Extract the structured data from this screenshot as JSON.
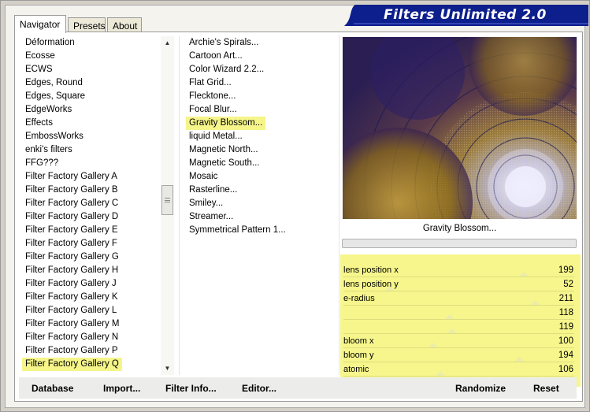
{
  "app": {
    "title": "Filters Unlimited 2.0"
  },
  "tabs": [
    {
      "label": "Navigator",
      "active": true
    },
    {
      "label": "Presets",
      "active": false
    },
    {
      "label": "About",
      "active": false
    }
  ],
  "categories": [
    "Déformation",
    "Ecosse",
    "ECWS",
    "Edges, Round",
    "Edges, Square",
    "EdgeWorks",
    "Effects",
    "EmbossWorks",
    "enki's filters",
    "FFG???",
    "Filter Factory Gallery A",
    "Filter Factory Gallery B",
    "Filter Factory Gallery C",
    "Filter Factory Gallery D",
    "Filter Factory Gallery E",
    "Filter Factory Gallery F",
    "Filter Factory Gallery G",
    "Filter Factory Gallery H",
    "Filter Factory Gallery J",
    "Filter Factory Gallery K",
    "Filter Factory Gallery L",
    "Filter Factory Gallery M",
    "Filter Factory Gallery N",
    "Filter Factory Gallery P",
    "Filter Factory Gallery Q"
  ],
  "selected_category": "Filter Factory Gallery Q",
  "filters": [
    "Archie's Spirals...",
    "Cartoon Art...",
    "Color Wizard 2.2...",
    "Flat Grid...",
    "Flecktone...",
    "Focal Blur...",
    "Gravity Blossom...",
    "liquid Metal...",
    "Magnetic North...",
    "Magnetic South...",
    "Mosaic",
    "Rasterline...",
    "Smiley...",
    "Streamer...",
    "Symmetrical Pattern 1..."
  ],
  "selected_filter": "Gravity Blossom...",
  "preview": {
    "caption": "Gravity Blossom..."
  },
  "params": [
    {
      "label": "lens position x",
      "value": "199",
      "level": 0.78
    },
    {
      "label": "lens position y",
      "value": "52",
      "level": 0.2
    },
    {
      "label": "e-radius",
      "value": "211",
      "level": 0.83
    },
    {
      "label": "",
      "value": "118",
      "level": 0.46
    },
    {
      "label": "",
      "value": "119",
      "level": 0.47
    },
    {
      "label": "bloom x",
      "value": "100",
      "level": 0.39
    },
    {
      "label": "bloom y",
      "value": "194",
      "level": 0.76
    },
    {
      "label": "atomic",
      "value": "106",
      "level": 0.42
    }
  ],
  "buttons": {
    "database": "Database",
    "import": "Import...",
    "filter_info": "Filter Info...",
    "editor": "Editor...",
    "randomize": "Randomize",
    "reset": "Reset"
  },
  "colors": {
    "highlight": "#f5f58a",
    "banner": "#0d1f8c"
  }
}
